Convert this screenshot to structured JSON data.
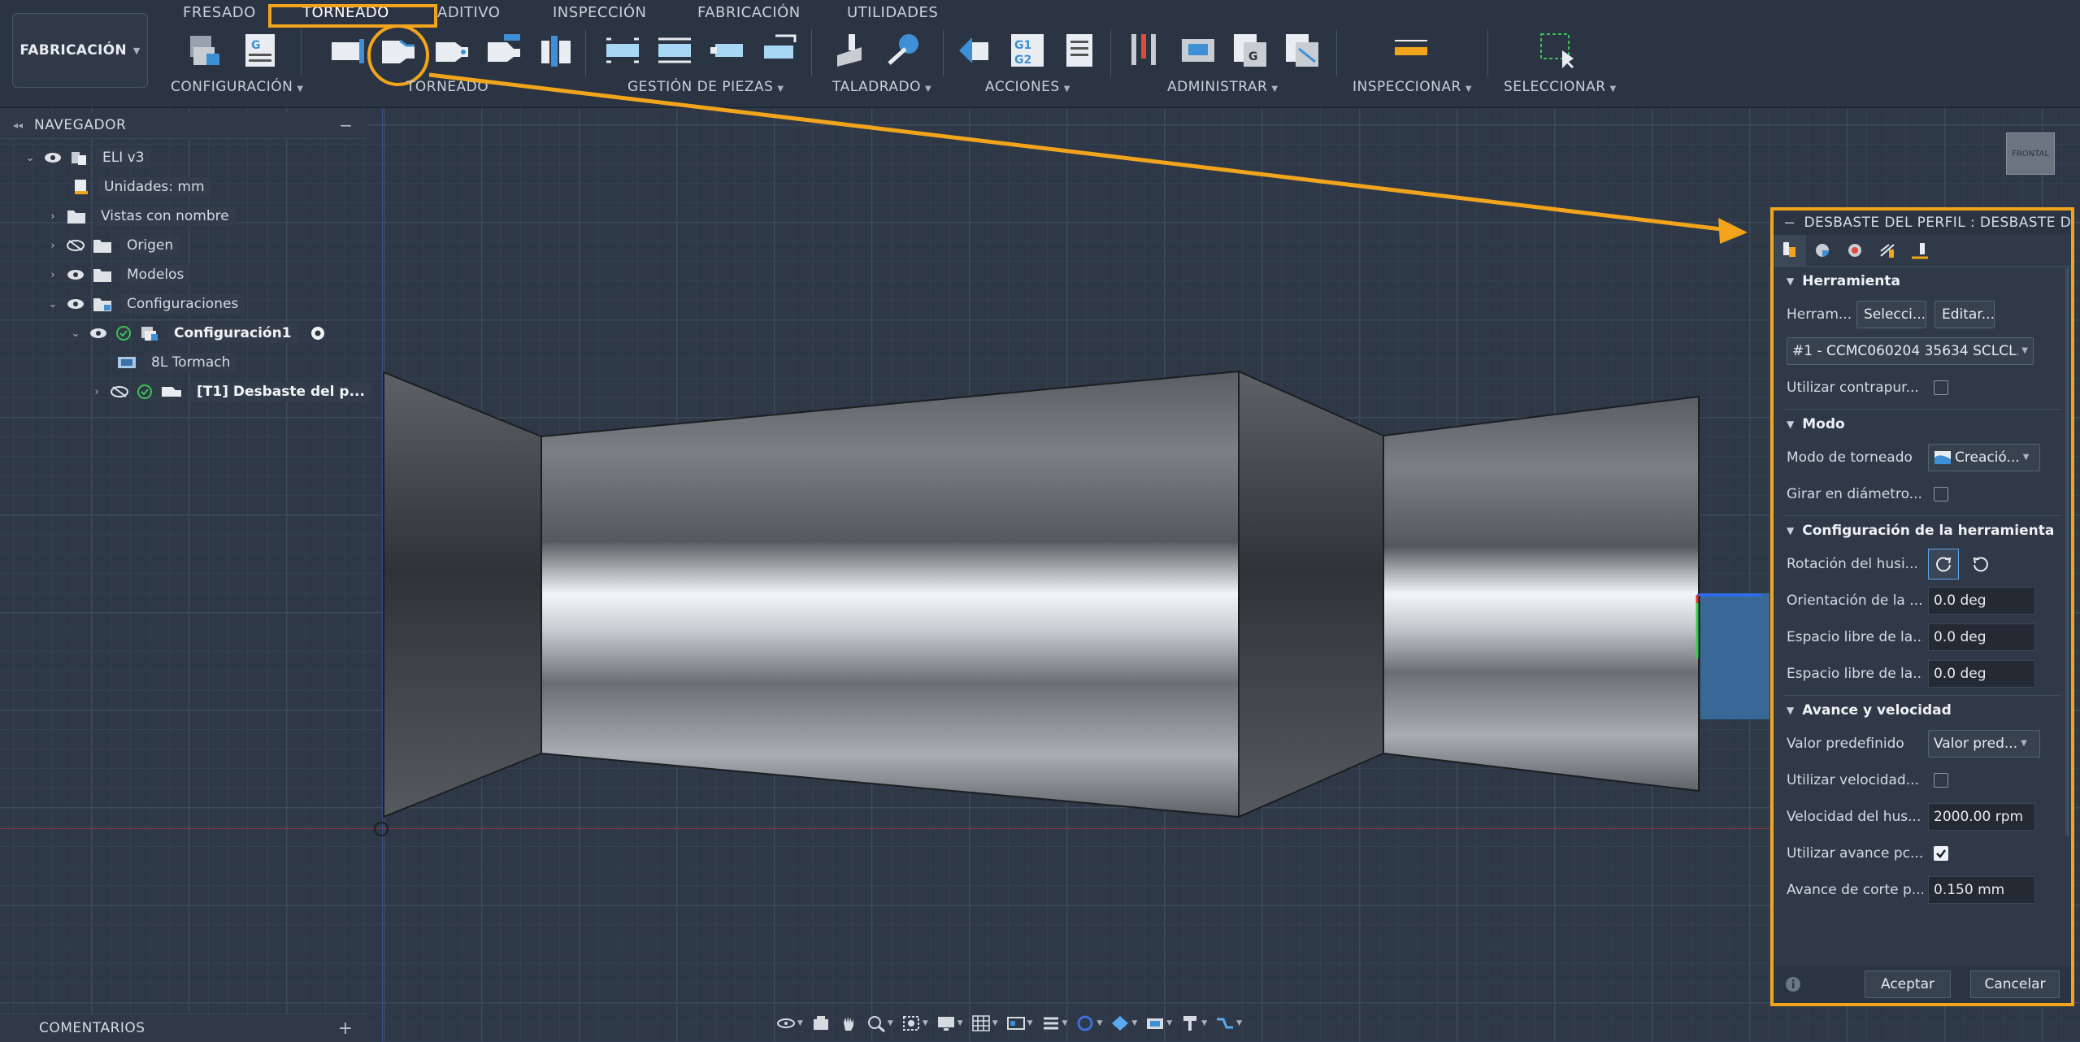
{
  "workspace": {
    "label": "FABRICACIÓN"
  },
  "tabs": [
    {
      "label": "FRESADO"
    },
    {
      "label": "TORNEADO"
    },
    {
      "label": "ADITIVO"
    },
    {
      "label": "INSPECCIÓN"
    },
    {
      "label": "FABRICACIÓN"
    },
    {
      "label": "UTILIDADES"
    }
  ],
  "groups": {
    "configuracion": "CONFIGURACIÓN",
    "torneado": "TORNEADO",
    "gestion": "GESTIÓN DE PIEZAS",
    "taladrado": "TALADRADO",
    "acciones": "ACCIONES",
    "administrar": "ADMINISTRAR",
    "inspeccionar": "INSPECCIONAR",
    "seleccionar": "SELECCIONAR"
  },
  "navigator": {
    "title": "NAVEGADOR",
    "items": [
      {
        "label": "ELI v3"
      },
      {
        "label": "Unidades: mm"
      },
      {
        "label": "Vistas con nombre"
      },
      {
        "label": "Origen"
      },
      {
        "label": "Modelos"
      },
      {
        "label": "Configuraciones"
      },
      {
        "label": "Configuración1"
      },
      {
        "label": "8L Tormach"
      },
      {
        "label": "[T1] Desbaste del p..."
      }
    ]
  },
  "comments": {
    "title": "COMENTARIOS"
  },
  "viewcube": {
    "label": "FRONTAL"
  },
  "dialog": {
    "title": "DESBASTE DEL PERFIL : DESBASTE DEL",
    "sections": {
      "herramienta": "Herramienta",
      "modo": "Modo",
      "config_herr": "Configuración de la herramienta",
      "avance": "Avance y velocidad"
    },
    "rows": {
      "herramienta_label": "Herram...",
      "seleccionar_btn": "Selecci...",
      "editar_btn": "Editar...",
      "tool_select": "#1 - CCMC060204 35634 SCLCL...",
      "contrapunto": "Utilizar contrapur...",
      "modo_torneado": "Modo de torneado",
      "modo_value": "Creació...",
      "girar_diametro": "Girar en diámetro...",
      "rotacion_husillo": "Rotación del husi...",
      "orientacion": "Orientación de la ...",
      "orientacion_val": "0.0 deg",
      "espacio1": "Espacio libre de la...",
      "espacio1_val": "0.0 deg",
      "espacio2": "Espacio libre de la...",
      "espacio2_val": "0.0 deg",
      "valor_predef": "Valor predefinido",
      "valor_predef_val": "Valor pred...",
      "util_velocidad": "Utilizar velocidad...",
      "vel_husillo": "Velocidad del hus...",
      "vel_husillo_val": "2000.00 rpm",
      "util_avance": "Utilizar avance pc...",
      "avance_corte": "Avance de corte p...",
      "avance_corte_val": "0.150 mm"
    },
    "footer": {
      "accept": "Aceptar",
      "cancel": "Cancelar"
    }
  },
  "colors": {
    "accent": "#f2a51c",
    "background": "#2b3441"
  }
}
